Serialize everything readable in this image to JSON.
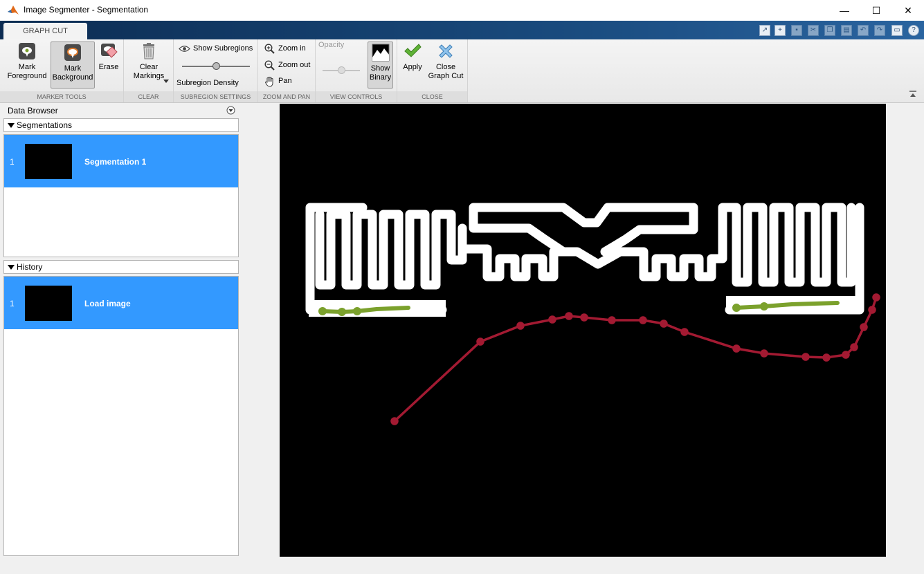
{
  "window": {
    "title": "Image Segmenter - Segmentation",
    "controls": [
      "—",
      "☐",
      "✕"
    ]
  },
  "tabs": [
    {
      "label": "GRAPH CUT",
      "active": true
    }
  ],
  "ribbon": {
    "marker_tools": {
      "label": "MARKER TOOLS",
      "mark_foreground": "Mark\nForeground",
      "mark_background": "Mark\nBackground",
      "erase": "Erase"
    },
    "clear": {
      "label": "CLEAR",
      "clear_markings": "Clear\nMarkings"
    },
    "subregion_settings": {
      "label": "SUBREGION SETTINGS",
      "show_subregions": "Show Subregions",
      "subregion_density": "Subregion Density",
      "density_value": 0.5
    },
    "zoom_and_pan": {
      "label": "ZOOM AND PAN",
      "zoom_in": "Zoom in",
      "zoom_out": "Zoom out",
      "pan": "Pan"
    },
    "view_controls": {
      "label": "VIEW CONTROLS",
      "opacity": "Opacity",
      "opacity_value": 0.5,
      "show_binary": "Show\nBinary"
    },
    "close": {
      "label": "CLOSE",
      "apply": "Apply",
      "close_graph_cut": "Close\nGraph Cut"
    }
  },
  "data_browser": {
    "title": "Data Browser",
    "segmentations": {
      "header": "Segmentations",
      "items": [
        {
          "index": "1",
          "label": "Segmentation 1"
        }
      ]
    },
    "history": {
      "header": "History",
      "items": [
        {
          "index": "1",
          "label": "Load image"
        }
      ]
    }
  },
  "colors": {
    "foreground_marker": "#7ba12c",
    "background_marker": "#a31a32",
    "selection": "#3399ff",
    "toolstrip": "#194a7d"
  }
}
